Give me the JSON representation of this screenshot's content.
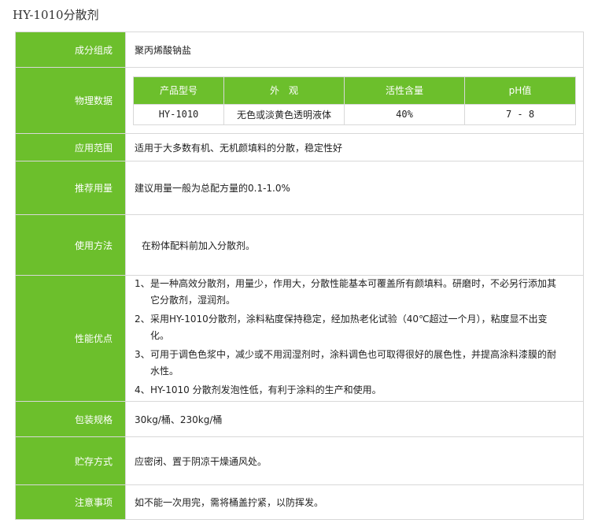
{
  "title": "HY-1010分散剂",
  "rows": {
    "composition": {
      "label": "成分组成",
      "value": "聚丙烯酸钠盐"
    },
    "physical": {
      "label": "物理数据",
      "headers": [
        "产品型号",
        "外　观",
        "活性含量",
        "pH值"
      ],
      "cells": [
        "HY-1010",
        "无色或淡黄色透明液体",
        "40%",
        "7 - 8"
      ]
    },
    "application": {
      "label": "应用范围",
      "value": "适用于大多数有机、无机颜填料的分散，稳定性好"
    },
    "dosage": {
      "label": "推荐用量",
      "value": "建议用量一般为总配方量的0.1-1.0%"
    },
    "usage": {
      "label": "使用方法",
      "value": "在粉体配料前加入分散剂。"
    },
    "advantages": {
      "label": "性能优点",
      "items": [
        {
          "num": "1、",
          "text": "是一种高效分散剂，用量少，作用大，分散性能基本可覆盖所有颜填料。研磨时，不必另行添加其它分散剂，湿润剂。"
        },
        {
          "num": "2、",
          "text": "采用HY-1010分散剂，涂料粘度保持稳定，经加热老化试验（40℃超过一个月），粘度显不出变化。"
        },
        {
          "num": "3、",
          "text": "可用于调色色浆中，减少或不用润湿剂时，涂料调色也可取得很好的展色性，并提高涂料漆膜的耐水性。"
        },
        {
          "num": "4、",
          "text": "HY-1010 分散剂发泡性低，有利于涂料的生产和使用。"
        }
      ]
    },
    "packaging": {
      "label": "包装规格",
      "value": "30kg/桶、230kg/桶"
    },
    "storage": {
      "label": "贮存方式",
      "value": "应密闭、置于阴凉干燥通风处。"
    },
    "notes": {
      "label": "注意事项",
      "value": "如不能一次用完，需将桶盖拧紧，以防挥发。"
    }
  }
}
